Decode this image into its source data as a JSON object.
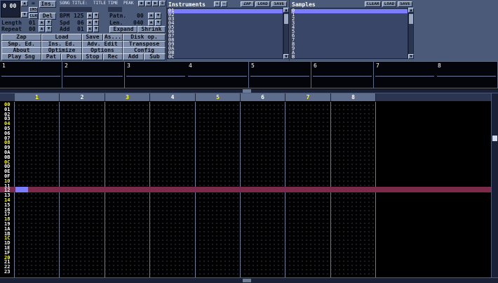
{
  "colors": {
    "accent": "#ffff00",
    "highlight": "#7b2a4a",
    "cursor": "#7c7cff"
  },
  "position": {
    "value": "0 00"
  },
  "top": {
    "ins_label": "Ins.",
    "del_label": "Del",
    "ins_small": "INS",
    "del_small": "CLR",
    "song_title_label": "SONG TITLE:",
    "title_label": "TITLE",
    "time_label": "TIME",
    "peak_label": "PEAK"
  },
  "params": {
    "length_label": "Length",
    "length_value": "01",
    "repeat_label": "Repeat",
    "repeat_value": "00",
    "bpm_label": "BPM",
    "bpm_value": "125",
    "spd_label": "Spd",
    "spd_value": "06",
    "add_label": "Add",
    "add_value": "01",
    "patn_label": "Patn.",
    "patn_value": "00",
    "len_label": "Len.",
    "len_value": "040",
    "expand_label": "Expand",
    "shrink_label": "Shrink"
  },
  "buttons": [
    [
      "Zap",
      "Load",
      "Save",
      "As...",
      "Disk op."
    ],
    [
      "Smp. Ed.",
      "Ins. Ed.",
      "Adv. Edit",
      "Transpose"
    ],
    [
      "About",
      "Optimize",
      "Options",
      "Config"
    ],
    [
      "Play Sng",
      "Pat",
      "Pos",
      "Stop",
      "Rec",
      "Add",
      "Sub"
    ]
  ],
  "instruments": {
    "title": "Instruments",
    "zap": "ZAP",
    "load": "LOAD",
    "save": "SAVE",
    "numbers": [
      "01",
      "02",
      "03",
      "04",
      "05",
      "06",
      "07",
      "08",
      "09",
      "0A",
      "0B",
      "0C"
    ]
  },
  "samples": {
    "title": "Samples",
    "clear": "CLEAR",
    "load": "LOAD",
    "save": "SAVE",
    "numbers": [
      "0",
      "1",
      "2",
      "3",
      "4",
      "5",
      "6",
      "7",
      "8",
      "9",
      "A",
      "B"
    ]
  },
  "scopes": [
    "1",
    "2",
    "3",
    "4",
    "5",
    "6",
    "7",
    "8"
  ],
  "channels": [
    "1",
    "2",
    "3",
    "4",
    "5",
    "6",
    "7",
    "8"
  ],
  "rows": [
    "00",
    "01",
    "02",
    "03",
    "04",
    "05",
    "06",
    "07",
    "08",
    "09",
    "0A",
    "0B",
    "0C",
    "0D",
    "0E",
    "0F",
    "10",
    "11",
    "12",
    "13",
    "14",
    "15",
    "16",
    "17",
    "18",
    "19",
    "1A",
    "1B",
    "1C",
    "1D",
    "1E",
    "1F",
    "20",
    "21",
    "22",
    "23"
  ]
}
